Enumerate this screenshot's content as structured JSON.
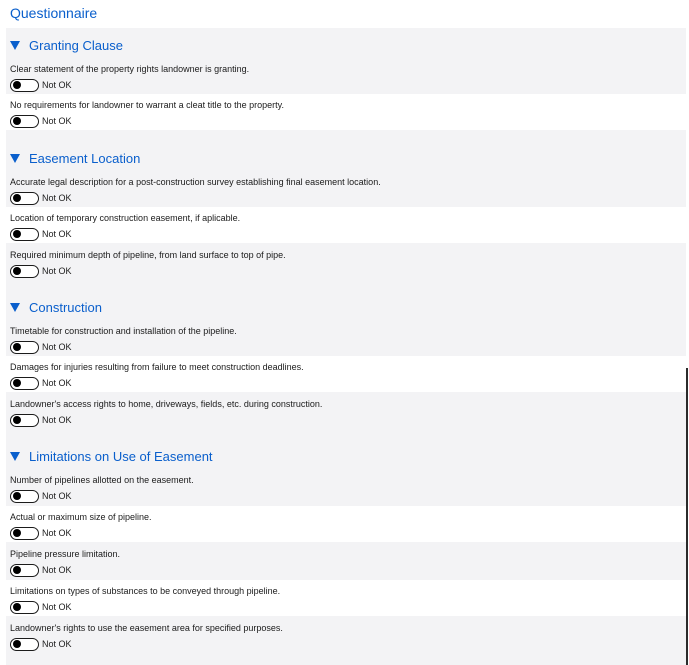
{
  "page": {
    "title": "Questionnaire"
  },
  "toggle_off_label": "Not OK",
  "colors": {
    "accent": "#0a5fcc",
    "panel": "#f3f3f5",
    "row_alt": "#ffffff"
  },
  "sections": [
    {
      "title": "Granting Clause",
      "questions": [
        {
          "text": "Clear statement of the property rights landowner is granting.",
          "status": "Not OK"
        },
        {
          "text": "No requirements for landowner to warrant a cleat title to the property.",
          "status": "Not OK"
        }
      ]
    },
    {
      "title": "Easement Location",
      "questions": [
        {
          "text": "Accurate legal description for a post-construction survey establishing final easement location.",
          "status": "Not OK"
        },
        {
          "text": "Location of temporary construction easement, if aplicable.",
          "status": "Not OK"
        },
        {
          "text": "Required minimum depth of pipeline, from land surface to top of pipe.",
          "status": "Not OK"
        }
      ]
    },
    {
      "title": "Construction",
      "questions": [
        {
          "text": "Timetable for construction and installation of the pipeline.",
          "status": "Not OK"
        },
        {
          "text": "Damages for injuries resulting from failure to meet construction deadlines.",
          "status": "Not OK"
        },
        {
          "text": "Landowner's access rights to home, driveways, fields, etc. during construction.",
          "status": "Not OK"
        }
      ]
    },
    {
      "title": "Limitations on Use of Easement",
      "questions": [
        {
          "text": "Number of pipelines allotted on the easement.",
          "status": "Not OK"
        },
        {
          "text": "Actual or maximum size of pipeline.",
          "status": "Not OK"
        },
        {
          "text": "Pipeline pressure limitation.",
          "status": "Not OK"
        },
        {
          "text": "Limitations on types of substances to be conveyed through pipeline.",
          "status": "Not OK"
        },
        {
          "text": "Landowner's rights to use the easement area for specified purposes.",
          "status": "Not OK"
        }
      ]
    }
  ]
}
